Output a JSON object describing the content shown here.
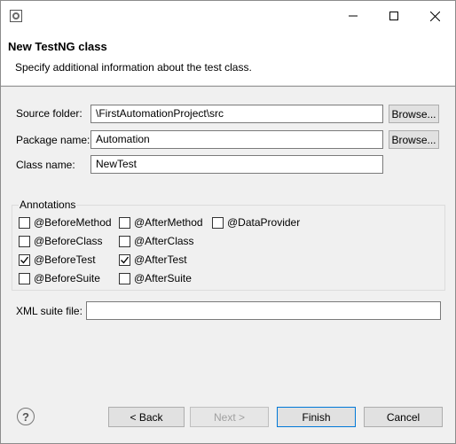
{
  "titlebar": {
    "minimize_icon": "minimize-icon",
    "maximize_icon": "maximize-icon",
    "close_icon": "close-icon"
  },
  "header": {
    "title": "New TestNG class",
    "description": "Specify additional information about the test class."
  },
  "form": {
    "source_folder": {
      "label": "Source folder:",
      "value": "\\FirstAutomationProject\\src",
      "button": "Browse..."
    },
    "package_name": {
      "label": "Package name:",
      "value": "Automation",
      "button": "Browse..."
    },
    "class_name": {
      "label": "Class name:",
      "value": "NewTest"
    }
  },
  "annotations": {
    "title": "Annotations",
    "items": [
      {
        "label": "@BeforeMethod",
        "checked": false
      },
      {
        "label": "@AfterMethod",
        "checked": false
      },
      {
        "label": "@DataProvider",
        "checked": false
      },
      {
        "label": "@BeforeClass",
        "checked": false
      },
      {
        "label": "@AfterClass",
        "checked": false
      },
      {
        "label": "@BeforeTest",
        "checked": true
      },
      {
        "label": "@AfterTest",
        "checked": true
      },
      {
        "label": "@BeforeSuite",
        "checked": false
      },
      {
        "label": "@AfterSuite",
        "checked": false
      }
    ]
  },
  "xml_suite": {
    "label": "XML suite file:",
    "value": ""
  },
  "footer": {
    "help_symbol": "?",
    "back": "< Back",
    "next": "Next >",
    "finish": "Finish",
    "cancel": "Cancel"
  },
  "colors": {
    "default_button_border": "#0078d7",
    "background": "#f0f0f0"
  }
}
